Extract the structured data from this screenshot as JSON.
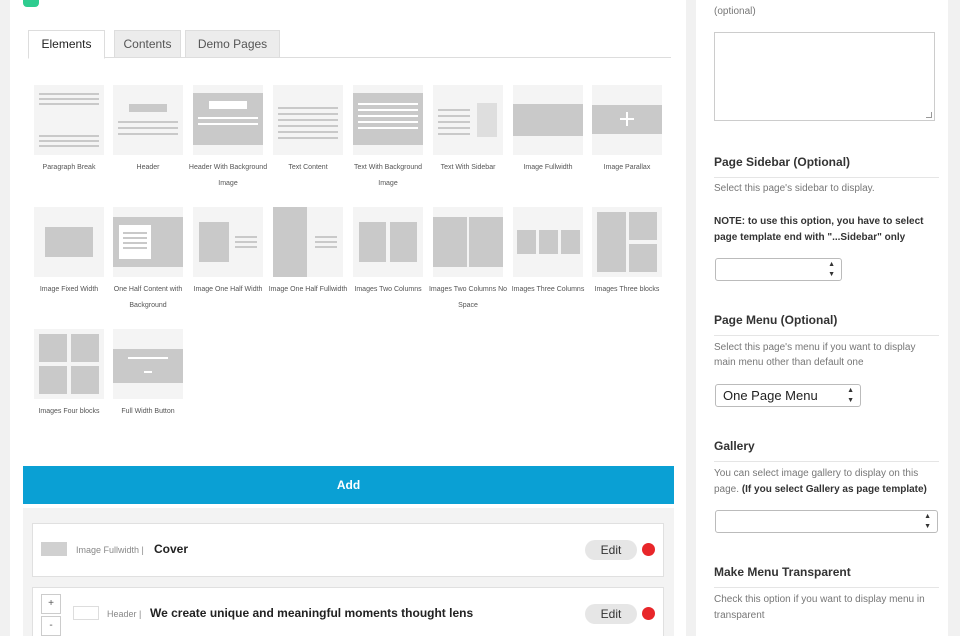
{
  "tabs": [
    "Elements",
    "Contents",
    "Demo Pages"
  ],
  "elements": [
    {
      "label": "Paragraph Break",
      "icon": "paragraph-break-icon"
    },
    {
      "label": "Header",
      "icon": "header-icon"
    },
    {
      "label": "Header With Background Image",
      "icon": "header-background-icon"
    },
    {
      "label": "Text Content",
      "icon": "text-content-icon"
    },
    {
      "label": "Text With Background Image",
      "icon": "text-background-icon"
    },
    {
      "label": "Text With Sidebar",
      "icon": "text-sidebar-icon"
    },
    {
      "label": "Image Fullwidth",
      "icon": "image-fullwidth-icon"
    },
    {
      "label": "Image Parallax",
      "icon": "image-parallax-icon"
    },
    {
      "label": "Image Fixed Width",
      "icon": "image-fixed-width-icon"
    },
    {
      "label": "One Half Content with Background",
      "icon": "half-content-background-icon"
    },
    {
      "label": "Image One Half Width",
      "icon": "image-half-width-icon"
    },
    {
      "label": "Image One Half Fullwidth",
      "icon": "image-half-fullwidth-icon"
    },
    {
      "label": "Images Two Columns",
      "icon": "images-two-columns-icon"
    },
    {
      "label": "Images Two Columns No Space",
      "icon": "images-two-columns-nospace-icon"
    },
    {
      "label": "Images Three Columns",
      "icon": "images-three-columns-icon"
    },
    {
      "label": "Images Three blocks",
      "icon": "images-three-blocks-icon"
    },
    {
      "label": "Images Four blocks",
      "icon": "images-four-blocks-icon"
    },
    {
      "label": "Full Width Button",
      "icon": "full-width-button-icon"
    }
  ],
  "add_label": "Add",
  "rows": [
    {
      "type": "Image Fullwidth |",
      "title": "Cover",
      "edit": "Edit"
    },
    {
      "type": "Header |",
      "title": "We create unique and meaningful moments thought lens",
      "edit": "Edit"
    }
  ],
  "sort": {
    "up": "+",
    "down": "-"
  },
  "sidebar": {
    "top_text": "(optional)",
    "page_sidebar": {
      "title": "Page Sidebar (Optional)",
      "desc": "Select this page's sidebar to display.",
      "note_line1": "NOTE: to use this option, you have to select",
      "note_line2": "page template end with \"...Sidebar\" only",
      "value": ""
    },
    "page_menu": {
      "title": "Page Menu (Optional)",
      "desc_line1": "Select this page's menu if you want to display",
      "desc_line2": "main menu other than default one",
      "value": "One Page Menu"
    },
    "gallery": {
      "title": "Gallery",
      "desc_line1": "You can select image gallery to display on this",
      "desc_line2": "page.",
      "desc_bold": "(If you select Gallery as page template)",
      "value": ""
    },
    "transparent": {
      "title": "Make Menu Transparent",
      "desc_line1": "Check this option if you want to display menu in",
      "desc_line2": "transparent"
    }
  },
  "colors": {
    "accent": "#0aa0d4",
    "delete": "#e8262a",
    "badge": "#2ecc8f"
  }
}
